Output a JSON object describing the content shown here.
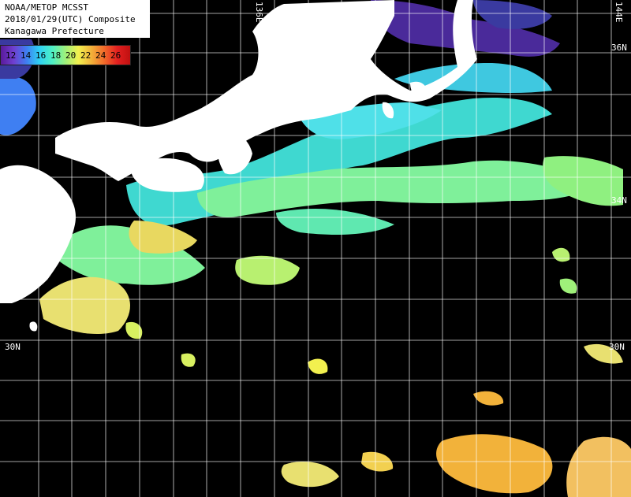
{
  "title": {
    "line1": "NOAA/METOP MCSST",
    "line2": "2018/01/29(UTC) Composite",
    "line3": "Kanagawa Prefecture"
  },
  "legend": {
    "values": [
      "12",
      "14",
      "16",
      "18",
      "20",
      "22",
      "24",
      "26"
    ],
    "colors": [
      "#5a1a9a",
      "#3f7ff2",
      "#2fd2f2",
      "#4ff0c4",
      "#9ff07a",
      "#f2f04f",
      "#f2b23a",
      "#e22020"
    ]
  },
  "grid_labels": {
    "lon_136": "136E",
    "lon_144": "144E",
    "lat_36": "36N",
    "lat_34": "34N",
    "lat_30_left": "30N",
    "lat_30_right": "30N"
  },
  "colors": {
    "land": "#ffffff",
    "no_data": "#000000",
    "grid": "#ffffff"
  }
}
